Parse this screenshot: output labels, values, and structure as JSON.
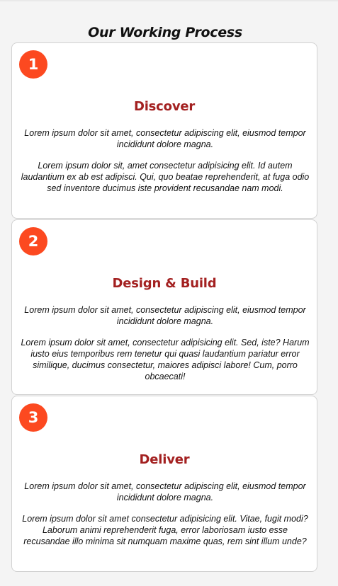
{
  "page": {
    "title": "Our Working Process"
  },
  "steps": [
    {
      "number": "1",
      "title": "Discover",
      "paragraph1": "Lorem ipsum dolor sit amet, consectetur adipiscing elit, eiusmod tempor incididunt dolore magna.",
      "paragraph2": "Lorem ipsum dolor sit, amet consectetur adipisicing elit. Id autem laudantium ex ab est adipisci. Qui, quo beatae reprehenderit, at fuga odio sed inventore ducimus iste provident recusandae nam modi."
    },
    {
      "number": "2",
      "title": "Design & Build",
      "paragraph1": "Lorem ipsum dolor sit amet, consectetur adipiscing elit, eiusmod tempor incididunt dolore magna.",
      "paragraph2": "Lorem ipsum dolor sit amet, consectetur adipisicing elit. Sed, iste? Harum iusto eius temporibus rem tenetur qui quasi laudantium pariatur error similique, ducimus consectetur, maiores adipisci labore! Cum, porro obcaecati!"
    },
    {
      "number": "3",
      "title": "Deliver",
      "paragraph1": "Lorem ipsum dolor sit amet, consectetur adipiscing elit, eiusmod tempor incididunt dolore magna.",
      "paragraph2": "Lorem ipsum dolor sit amet consectetur adipisicing elit. Vitae, fugit modi? Laborum animi reprehenderit fuga, error laboriosam iusto esse recusandae illo minima sit numquam maxime quas, rem sint illum unde?"
    }
  ],
  "colors": {
    "badge": "#fc4920",
    "step_title": "#a32020",
    "background": "#f4f4f4",
    "card": "#ffffff"
  }
}
